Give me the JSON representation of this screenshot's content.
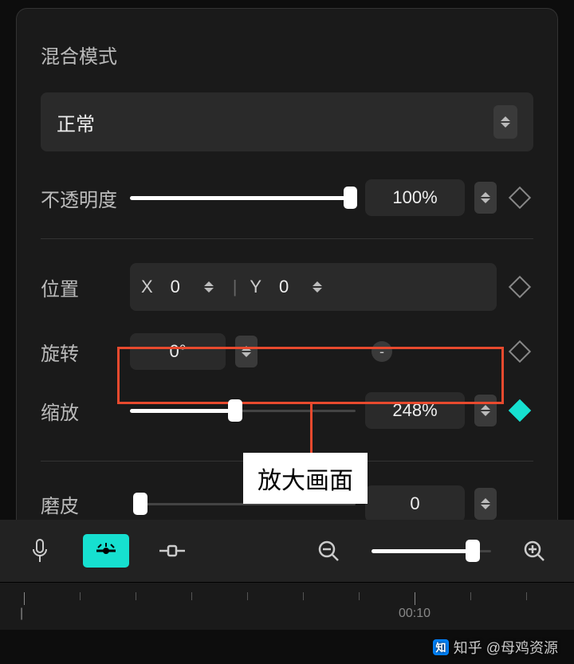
{
  "blend": {
    "label": "混合模式",
    "selected": "正常"
  },
  "opacity": {
    "label": "不透明度",
    "value": "100%",
    "percent": 100
  },
  "position": {
    "label": "位置",
    "x_label": "X",
    "x_value": "0",
    "y_label": "Y",
    "y_value": "0"
  },
  "rotation": {
    "label": "旋转",
    "value": "0°",
    "extra": "-"
  },
  "scale": {
    "label": "缩放",
    "value": "248%",
    "percent": 40
  },
  "smooth": {
    "label": "磨皮",
    "value": "0",
    "percent": 0
  },
  "callout": "放大画面",
  "timeline": {
    "t1": "|",
    "t2": "00:10"
  },
  "watermark": "知乎 @母鸡资源"
}
